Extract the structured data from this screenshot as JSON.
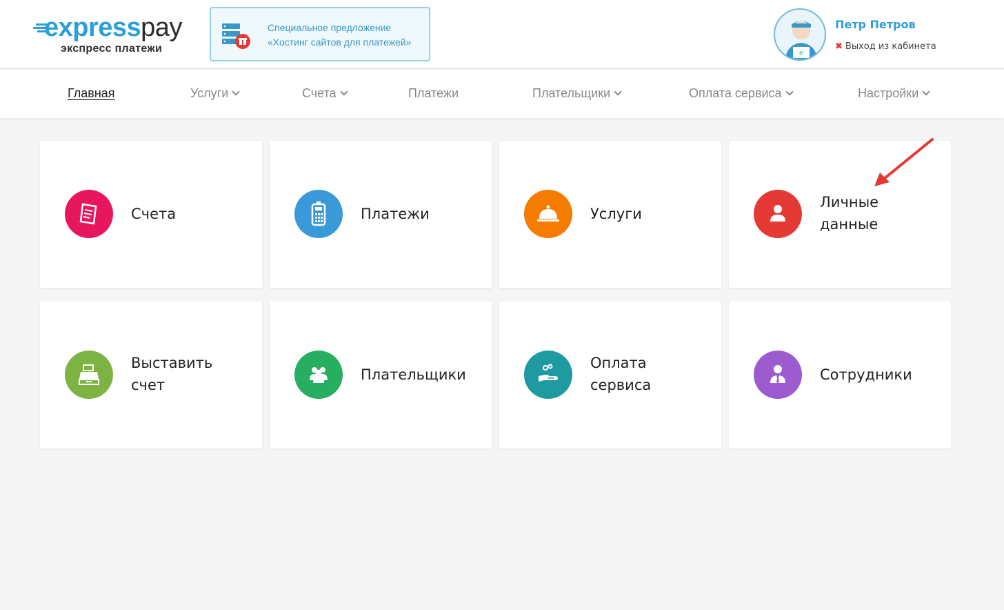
{
  "brand": {
    "word_blue": "express",
    "word_dark": "pay",
    "subtitle": "экспресс платежи"
  },
  "promo": {
    "line1": "Специальное предложение",
    "line2": "«Хостинг сайтов для платежей»"
  },
  "user": {
    "name": "Петр Петров",
    "logout": "Выход из кабинета"
  },
  "nav": {
    "items": [
      {
        "label": "Главная",
        "active": true,
        "dropdown": false
      },
      {
        "label": "Услуги",
        "active": false,
        "dropdown": true
      },
      {
        "label": "Счета",
        "active": false,
        "dropdown": true
      },
      {
        "label": "Платежи",
        "active": false,
        "dropdown": false
      },
      {
        "label": "Плательщики",
        "active": false,
        "dropdown": true
      },
      {
        "label": "Оплата сервиса",
        "active": false,
        "dropdown": true
      },
      {
        "label": "Настройки",
        "active": false,
        "dropdown": true
      }
    ]
  },
  "tiles": [
    {
      "label": "Счета",
      "icon": "invoice-icon",
      "color": "#e8175d"
    },
    {
      "label": "Платежи",
      "icon": "terminal-icon",
      "color": "#3a9ad9"
    },
    {
      "label": "Услуги",
      "icon": "cloche-icon",
      "color": "#f57c00"
    },
    {
      "label": "Личные данные",
      "icon": "person-icon",
      "color": "#e53935"
    },
    {
      "label": "Выставить счет",
      "icon": "cash-register-icon",
      "color": "#7cb342"
    },
    {
      "label": "Плательщики",
      "icon": "group-icon",
      "color": "#27ae60"
    },
    {
      "label": "Оплата сервиса",
      "icon": "hand-coin-icon",
      "color": "#1e9aa0"
    },
    {
      "label": "Сотрудники",
      "icon": "employee-icon",
      "color": "#9c5ccf"
    }
  ],
  "annotation": {
    "icon": "red-arrow-icon",
    "color": "#e53935"
  }
}
